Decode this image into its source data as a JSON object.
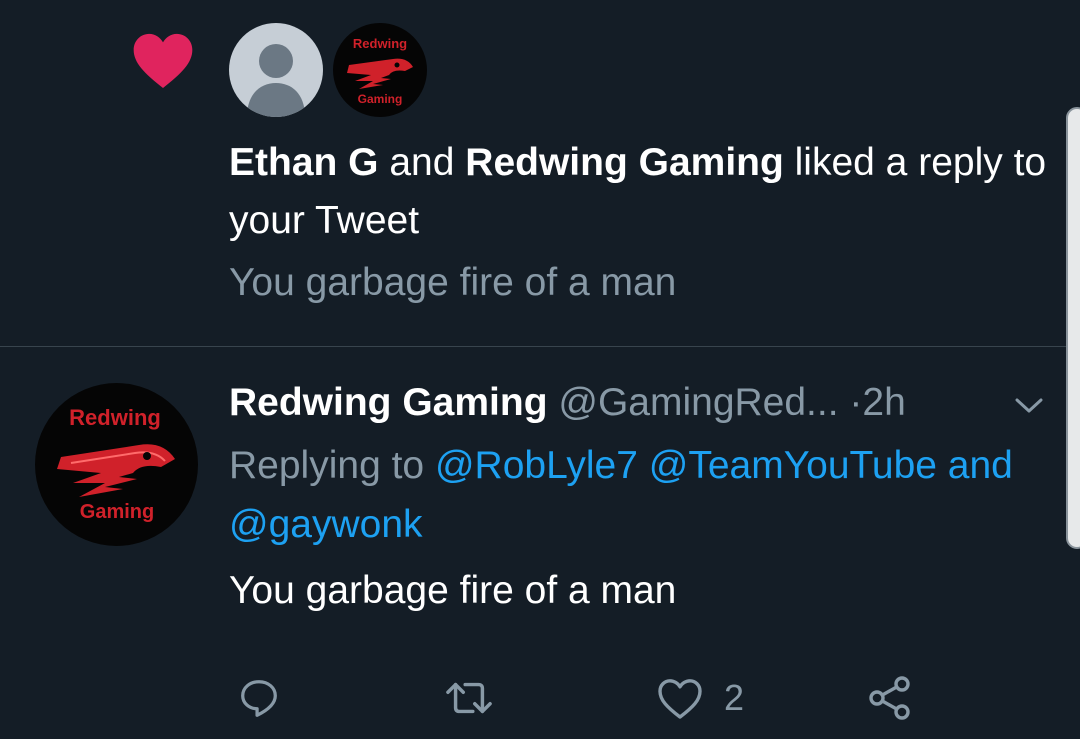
{
  "notification": {
    "user1": "Ethan G",
    "connector": "and",
    "user2": "Redwing Gaming",
    "action_text": "liked a reply to your Tweet",
    "preview": "You garbage fire of a man"
  },
  "tweet": {
    "display_name": "Redwing Gaming",
    "handle": "@GamingRed...",
    "separator": "·",
    "time": "2h",
    "replying_prefix": "Replying to",
    "mentions": [
      "@RobLyle7",
      "@TeamYouTube",
      "@gaywonk"
    ],
    "mentions_joiner": "and",
    "text": "You garbage fire of a man",
    "like_count": "2"
  },
  "logo": {
    "top_text": "Redwing",
    "bottom_text": "Gaming"
  },
  "colors": {
    "background": "#141d26",
    "heart": "#e0245e",
    "link": "#1da1f2",
    "muted": "#8899a6",
    "logo_red": "#d0212a"
  },
  "icons": [
    "heart-icon",
    "default-avatar-icon",
    "chevron-down-icon",
    "reply-icon",
    "retweet-icon",
    "like-icon",
    "share-icon"
  ]
}
